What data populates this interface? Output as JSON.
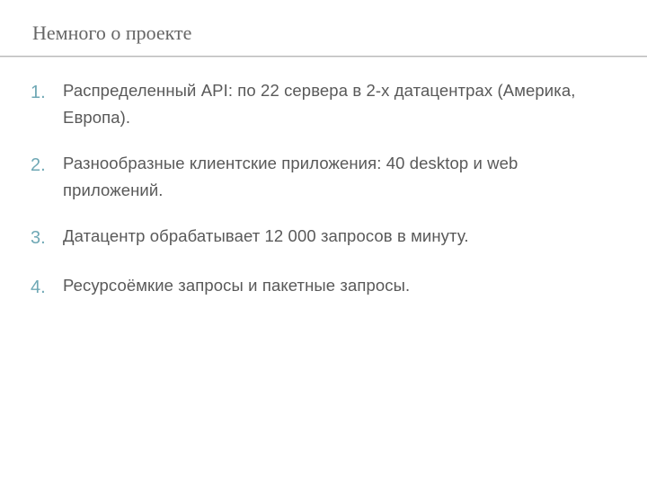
{
  "slide": {
    "title": "Немного о проекте",
    "items": [
      {
        "number": "1.",
        "text": "Распределенный API: по 22 сервера в 2-х датацентрах (Америка, Европа)."
      },
      {
        "number": "2.",
        "text": "Разнообразные клиентские приложения: 40 desktop и web приложений."
      },
      {
        "number": "3.",
        "text": "Датацентр обрабатывает 12 000 запросов в минуту."
      },
      {
        "number": "4.",
        "text": "Ресурсоёмкие запросы и пакетные запросы."
      }
    ]
  }
}
